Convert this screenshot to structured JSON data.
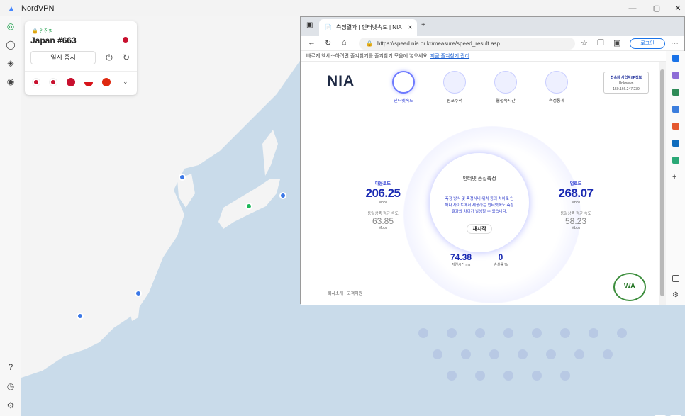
{
  "app": {
    "title": "NordVPN"
  },
  "connection": {
    "status": "안전함",
    "server": "Japan #663",
    "pause_label": "일시 중지"
  },
  "browser": {
    "tab_title": "측정결과 | 인터넷속도 | NIA",
    "url": "https://speed.nia.or.kr/measure/speed_result.asp",
    "login_label": "로그인",
    "favbar_text": "빠르게 액세스하려면 즐겨찾기를 즐겨찾기 모음에 넣으세요.",
    "favbar_link": "지금 즐겨찾기 관리"
  },
  "nia": {
    "logo": "NIA",
    "nav": [
      "인터넷속도",
      "원포주석",
      "웹접속시간",
      "측정통계"
    ],
    "ip_title": "접속자 사업자/IP정보",
    "ip_isp": "Unknown",
    "ip_addr": "150.166.247.239",
    "center_title": "인터넷 품질측정",
    "center_desc": "측정 방식 및 측정서버 위치 등의 차이로 인해다 사이트에서 제공하는 인터넷속도 측정결과와 차이가 발생할 수 있습니다.",
    "retest_label": "재시작",
    "download": {
      "label": "다운로드",
      "value": "206.25",
      "unit": "Mbps",
      "avg_label": "동일상품 평균 속도",
      "avg": "63.85",
      "avg_unit": "Mbps"
    },
    "upload": {
      "label": "업로드",
      "value": "268.07",
      "unit": "Mbps",
      "avg_label": "동일상품 평균 속도",
      "avg": "58.23",
      "avg_unit": "Mbps"
    },
    "latency": {
      "value": "74.38",
      "label": "지연시간 ms"
    },
    "loss": {
      "value": "0",
      "label": "손실률 %"
    },
    "footer": "회사소개  |  고객지원",
    "badge": "WA"
  },
  "zoom": {
    "minus": "−",
    "plus": "+"
  }
}
